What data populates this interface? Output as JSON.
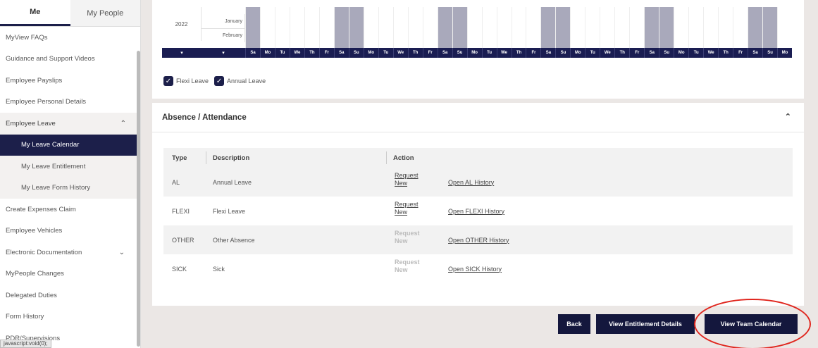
{
  "sidebar": {
    "tabs": [
      {
        "label": "Me"
      },
      {
        "label": "My People"
      }
    ],
    "items": [
      {
        "label": "MyView FAQs"
      },
      {
        "label": "Guidance and Support Videos"
      },
      {
        "label": "Employee Payslips"
      },
      {
        "label": "Employee Personal Details"
      },
      {
        "label": "Employee Leave"
      },
      {
        "label": "My Leave Calendar"
      },
      {
        "label": "My Leave Entitlement"
      },
      {
        "label": "My Leave Form History"
      },
      {
        "label": "Create Expenses Claim"
      },
      {
        "label": "Employee Vehicles"
      },
      {
        "label": "Electronic Documentation"
      },
      {
        "label": "MyPeople Changes"
      },
      {
        "label": "Delegated Duties"
      },
      {
        "label": "Form History"
      },
      {
        "label": "PDR/Supervisions"
      }
    ],
    "status_tip": "javascript:void(0);"
  },
  "calendar": {
    "year": "2022",
    "months": [
      "January",
      "February"
    ],
    "year_select": "▾",
    "month_select": "▾",
    "days": [
      "Sa",
      "Mo",
      "Tu",
      "We",
      "Th",
      "Fr",
      "Sa",
      "Su",
      "Mo",
      "Tu",
      "We",
      "Th",
      "Fr",
      "Sa",
      "Su",
      "Mo",
      "Tu",
      "We",
      "Th",
      "Fr",
      "Sa",
      "Su",
      "Mo",
      "Tu",
      "We",
      "Th",
      "Fr",
      "Sa",
      "Su",
      "Mo",
      "Tu",
      "We",
      "Th",
      "Fr",
      "Sa",
      "Su",
      "Mo"
    ],
    "legend": [
      {
        "label": "Flexi Leave"
      },
      {
        "label": "Annual Leave"
      }
    ]
  },
  "absence": {
    "title": "Absence / Attendance",
    "columns": {
      "type": "Type",
      "description": "Description",
      "action": "Action"
    },
    "rows": [
      {
        "type": "AL",
        "description": "Annual Leave",
        "request": [
          "Request",
          "New"
        ],
        "history": "Open AL History",
        "enabled": true
      },
      {
        "type": "FLEXI",
        "description": "Flexi Leave",
        "request": [
          "Request",
          "New"
        ],
        "history": "Open FLEXI History",
        "enabled": true
      },
      {
        "type": "OTHER",
        "description": "Other Absence",
        "request": [
          "Request",
          "New"
        ],
        "history": "Open OTHER History",
        "enabled": false
      },
      {
        "type": "SICK",
        "description": "Sick",
        "request": [
          "Request",
          "New"
        ],
        "history": "Open SICK History",
        "enabled": false
      }
    ]
  },
  "buttons": {
    "back": "Back",
    "entitlement": "View Entitlement Details",
    "team_calendar": "View Team Calendar"
  },
  "colors": {
    "navy": "#1c1f4a",
    "highlight": "#e0261e",
    "weekend": "#a9a9bb"
  }
}
